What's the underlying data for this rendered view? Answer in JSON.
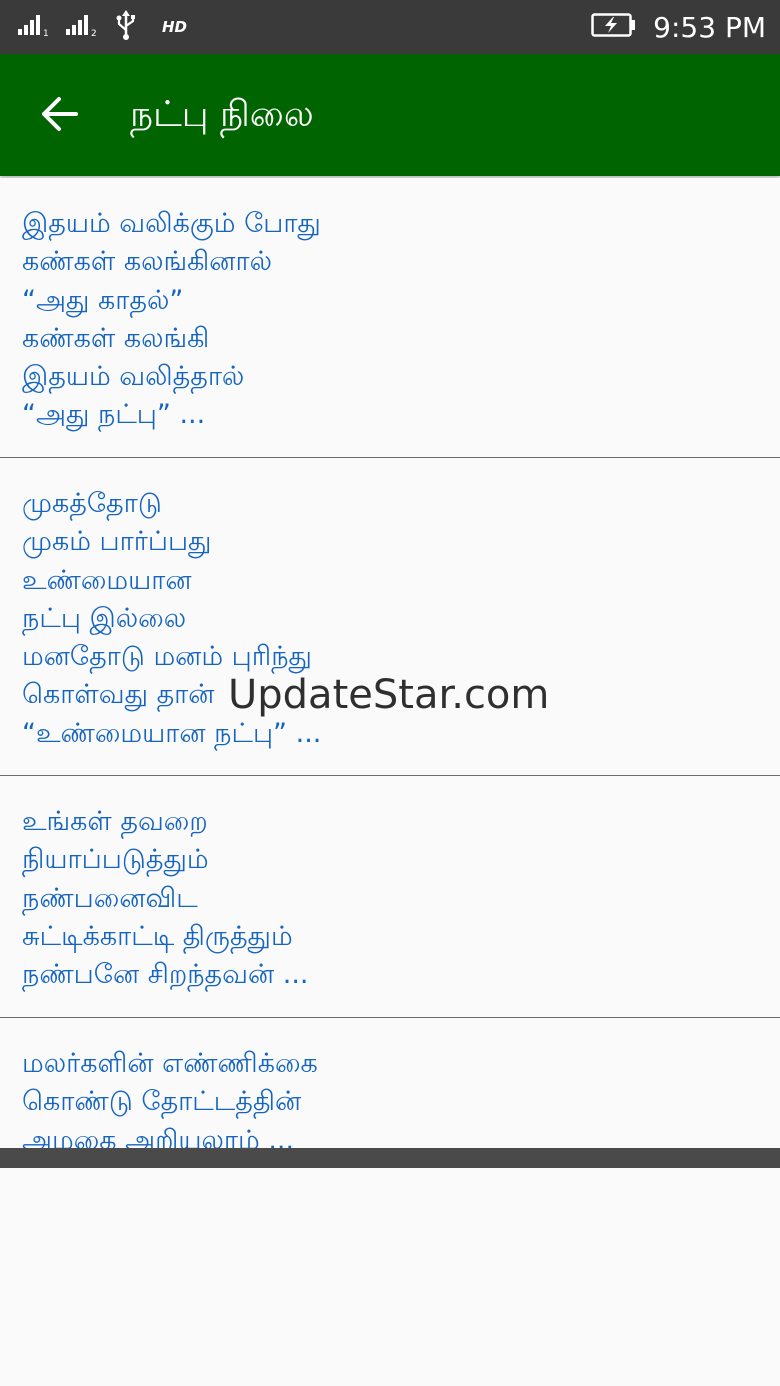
{
  "status_bar": {
    "time": "9:53 PM",
    "network_type": "HD",
    "icons": [
      "signal-sim1-icon",
      "signal-sim2-icon",
      "usb-icon",
      "battery-charging-icon"
    ]
  },
  "app_bar": {
    "title": "நட்பு நிலை",
    "back_icon": "arrow-back-icon",
    "color": "#006400"
  },
  "quotes": [
    {
      "text": "இதயம் வலிக்கும் போது\nகண்கள் கலங்கினால்\n“அது காதல்”\nகண்கள் கலங்கி\nஇதயம் வலித்தால்\n“அது நட்பு” ..."
    },
    {
      "text": "முகத்தோடு\nமுகம் பார்ப்பது\nஉண்மையான\nநட்பு இல்லை\nமனதோடு மனம் புரிந்து\nகொள்வது தான்\n“உண்மையான நட்பு” ..."
    },
    {
      "text": "உங்கள் தவறை\nநியாப்படுத்தும்\nநண்பனைவிட\nசுட்டிக்காட்டி திருத்தும்\nநண்பனே சிறந்தவன் ..."
    },
    {
      "text": "மலர்களின் எண்ணிக்கை\nகொண்டு தோட்டத்தின்\nஅழகை அறியலாம் ..."
    }
  ],
  "text_color": "#1565c0",
  "watermark": "UpdateStar.com"
}
